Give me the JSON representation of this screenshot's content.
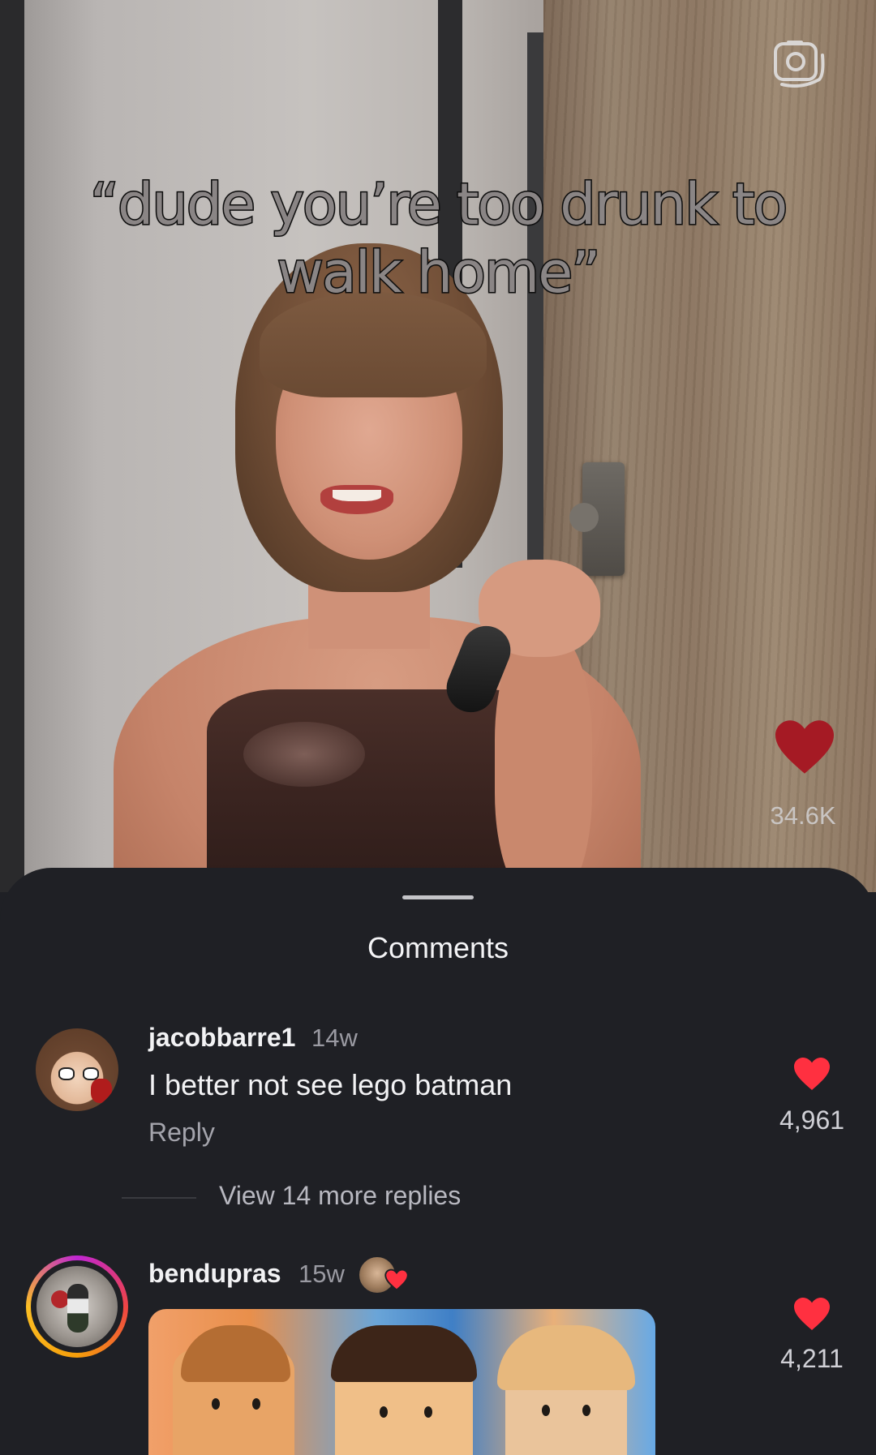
{
  "video": {
    "caption": "“dude you’re too drunk to walk home”",
    "like_count": "34.6K",
    "camera_icon": "camera-icon",
    "like_icon": "heart-icon",
    "heart_color": "#a51a24"
  },
  "comments_sheet": {
    "title": "Comments",
    "comments": [
      {
        "username": "jacobbarre1",
        "time": "14w",
        "text": "I better not see lego batman",
        "reply_label": "Reply",
        "likes": "4,961",
        "view_replies": "View 14 more replies"
      },
      {
        "username": "bendupras",
        "time": "15w",
        "likes": "4,211",
        "liked_by_creator": true
      }
    ],
    "like_heart_color": "#ff3040"
  }
}
